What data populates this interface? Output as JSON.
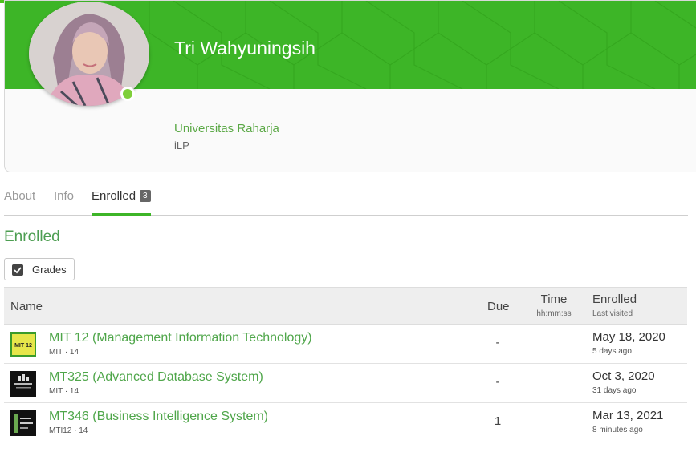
{
  "profile": {
    "name": "Tri Wahyuningsih",
    "organization": "Universitas Raharja",
    "sub": "iLP",
    "status": "online"
  },
  "tabs": [
    {
      "label": "About",
      "active": false
    },
    {
      "label": "Info",
      "active": false
    },
    {
      "label": "Enrolled",
      "active": true,
      "badge": "3"
    }
  ],
  "section_title": "Enrolled",
  "grades_button": "Grades",
  "table": {
    "headers": {
      "name": "Name",
      "due": "Due",
      "time": "Time",
      "time_sub": "hh:mm:ss",
      "enrolled": "Enrolled",
      "enrolled_sub": "Last visited"
    },
    "rows": [
      {
        "title": "MIT 12 (Management Information Technology)",
        "meta": "MIT · 14",
        "due": "-",
        "time": "",
        "enrolled": "May 18, 2020",
        "last_visited": "5 days ago",
        "thumb_text": "MIT 12"
      },
      {
        "title": "MT325 (Advanced Database System)",
        "meta": "MIT · 14",
        "due": "-",
        "time": "",
        "enrolled": "Oct 3, 2020",
        "last_visited": "31 days ago",
        "thumb_text": ""
      },
      {
        "title": "MT346 (Business Intelligence System)",
        "meta": "MTI12 · 14",
        "due": "1",
        "time": "",
        "enrolled": "Mar 13, 2021",
        "last_visited": "8 minutes ago",
        "thumb_text": ""
      }
    ]
  },
  "colors": {
    "brand_green": "#3db527",
    "link_green": "#4fa64a",
    "status_green": "#7fcf3a"
  }
}
